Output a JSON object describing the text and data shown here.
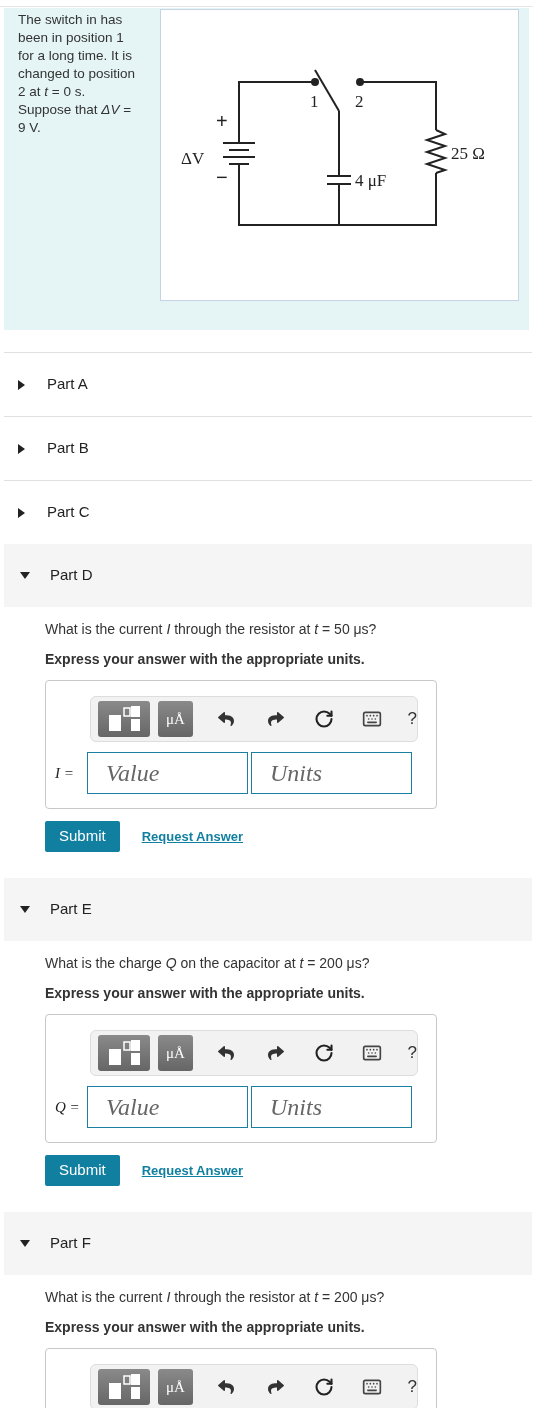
{
  "problem": {
    "text": "The switch in has been in position 1 for a long time. It is changed to position 2 at *t* = 0 s. Suppose that *ΔV* = 9 V.",
    "circuit_labels": {
      "plus": "+",
      "minus": "−",
      "source": "ΔV",
      "switch_1": "1",
      "switch_2": "2",
      "capacitor": "4 μF",
      "resistor": "25 Ω"
    }
  },
  "parts": [
    {
      "label": "Part A",
      "expanded": false
    },
    {
      "label": "Part B",
      "expanded": false
    },
    {
      "label": "Part C",
      "expanded": false
    },
    {
      "label": "Part D",
      "expanded": true,
      "question": "What is the current *I* through the resistor at *t* = 50 μs?",
      "instruction": "Express your answer with the appropriate units.",
      "units_button": "μÅ",
      "help": "?",
      "variable": "I =",
      "value_placeholder": "Value",
      "units_placeholder": "Units",
      "submit": "Submit",
      "request_answer": "Request Answer"
    },
    {
      "label": "Part E",
      "expanded": true,
      "question": "What is the charge *Q* on the capacitor at *t* = 200 μs?",
      "instruction": "Express your answer with the appropriate units.",
      "units_button": "μÅ",
      "help": "?",
      "variable": "Q =",
      "value_placeholder": "Value",
      "units_placeholder": "Units",
      "submit": "Submit",
      "request_answer": "Request Answer"
    },
    {
      "label": "Part F",
      "expanded": true,
      "question": "What is the current *I* through the resistor at *t* = 200 μs?",
      "instruction": "Express your answer with the appropriate units.",
      "units_button": "μÅ",
      "help": "?"
    }
  ]
}
